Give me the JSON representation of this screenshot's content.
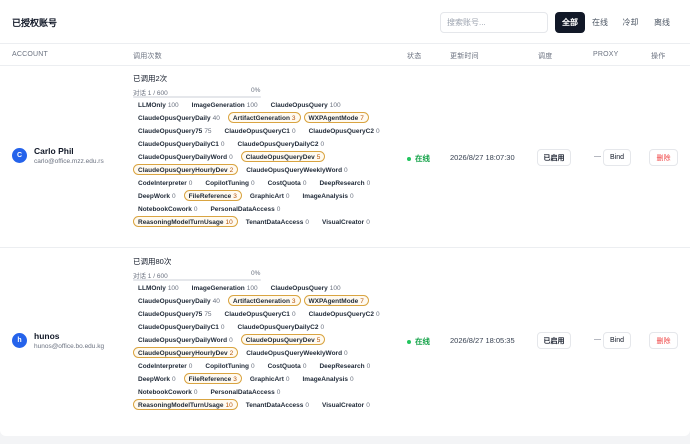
{
  "header": {
    "title": "已授权账号",
    "search_placeholder": "搜索账号...",
    "filters": [
      "全部",
      "在线",
      "冷却",
      "离线"
    ]
  },
  "columns": {
    "account": "ACCOUNT",
    "usage": "调用次数",
    "status": "状态",
    "updated": "更新时间",
    "schedule": "调度",
    "proxy": "PROXY",
    "actions": "操作"
  },
  "accounts": [
    {
      "avatar": "C",
      "name": "Carlo Phil",
      "email": "carlo@office.mzz.edu.rs",
      "used": "已调用2次",
      "quota": "对话 1 / 600",
      "percent_label": "0%",
      "percent_value": 0,
      "status": "在线",
      "updated": "2026/8/27 18:07:30",
      "schedule": "已启用",
      "proxy": "—",
      "bind": "Bind",
      "delete": "删除",
      "tags": [
        {
          "name": "LLMOnly",
          "count": "100",
          "hl": false
        },
        {
          "name": "ImageGeneration",
          "count": "100",
          "hl": false
        },
        {
          "name": "ClaudeOpusQuery",
          "count": "100",
          "hl": false
        },
        {
          "name": "ClaudeOpusQueryDaily",
          "count": "40",
          "hl": false
        },
        {
          "name": "ArtifactGeneration",
          "count": "3",
          "hl": true
        },
        {
          "name": "WXPAgentMode",
          "count": "7",
          "hl": true
        },
        {
          "name": "ClaudeOpusQuery75",
          "count": "75",
          "hl": false
        },
        {
          "name": "ClaudeOpusQueryC1",
          "count": "0",
          "hl": false
        },
        {
          "name": "ClaudeOpusQueryC2",
          "count": "0",
          "hl": false
        },
        {
          "name": "ClaudeOpusQueryDailyC1",
          "count": "0",
          "hl": false
        },
        {
          "name": "ClaudeOpusQueryDailyC2",
          "count": "0",
          "hl": false
        },
        {
          "name": "ClaudeOpusQueryDailyWord",
          "count": "0",
          "hl": false
        },
        {
          "name": "ClaudeOpusQueryDev",
          "count": "5",
          "hl": true
        },
        {
          "name": "ClaudeOpusQueryHourlyDev",
          "count": "2",
          "hl": true
        },
        {
          "name": "ClaudeOpusQueryWeeklyWord",
          "count": "0",
          "hl": false
        },
        {
          "name": "CodeInterpreter",
          "count": "0",
          "hl": false
        },
        {
          "name": "CopilotTuning",
          "count": "0",
          "hl": false
        },
        {
          "name": "CostQuota",
          "count": "0",
          "hl": false
        },
        {
          "name": "DeepResearch",
          "count": "0",
          "hl": false
        },
        {
          "name": "DeepWork",
          "count": "0",
          "hl": false
        },
        {
          "name": "FileReference",
          "count": "3",
          "hl": true
        },
        {
          "name": "GraphicArt",
          "count": "0",
          "hl": false
        },
        {
          "name": "ImageAnalysis",
          "count": "0",
          "hl": false
        },
        {
          "name": "NotebookCowork",
          "count": "0",
          "hl": false
        },
        {
          "name": "PersonalDataAccess",
          "count": "0",
          "hl": false
        },
        {
          "name": "ReasoningModelTurnUsage",
          "count": "10",
          "hl": true
        },
        {
          "name": "TenantDataAccess",
          "count": "0",
          "hl": false
        },
        {
          "name": "VisualCreator",
          "count": "0",
          "hl": false
        }
      ]
    },
    {
      "avatar": "h",
      "name": "hunos",
      "email": "hunos@office.bo.edu.kg",
      "used": "已调用80次",
      "quota": "对话 1 / 600",
      "percent_label": "0%",
      "percent_value": 0,
      "status": "在线",
      "updated": "2026/8/27 18:05:35",
      "schedule": "已启用",
      "proxy": "—",
      "bind": "Bind",
      "delete": "删除",
      "tags": [
        {
          "name": "LLMOnly",
          "count": "100",
          "hl": false
        },
        {
          "name": "ImageGeneration",
          "count": "100",
          "hl": false
        },
        {
          "name": "ClaudeOpusQuery",
          "count": "100",
          "hl": false
        },
        {
          "name": "ClaudeOpusQueryDaily",
          "count": "40",
          "hl": false
        },
        {
          "name": "ArtifactGeneration",
          "count": "3",
          "hl": true
        },
        {
          "name": "WXPAgentMode",
          "count": "7",
          "hl": true
        },
        {
          "name": "ClaudeOpusQuery75",
          "count": "75",
          "hl": false
        },
        {
          "name": "ClaudeOpusQueryC1",
          "count": "0",
          "hl": false
        },
        {
          "name": "ClaudeOpusQueryC2",
          "count": "0",
          "hl": false
        },
        {
          "name": "ClaudeOpusQueryDailyC1",
          "count": "0",
          "hl": false
        },
        {
          "name": "ClaudeOpusQueryDailyC2",
          "count": "0",
          "hl": false
        },
        {
          "name": "ClaudeOpusQueryDailyWord",
          "count": "0",
          "hl": false
        },
        {
          "name": "ClaudeOpusQueryDev",
          "count": "5",
          "hl": true
        },
        {
          "name": "ClaudeOpusQueryHourlyDev",
          "count": "2",
          "hl": true
        },
        {
          "name": "ClaudeOpusQueryWeeklyWord",
          "count": "0",
          "hl": false
        },
        {
          "name": "CodeInterpreter",
          "count": "0",
          "hl": false
        },
        {
          "name": "CopilotTuning",
          "count": "0",
          "hl": false
        },
        {
          "name": "CostQuota",
          "count": "0",
          "hl": false
        },
        {
          "name": "DeepResearch",
          "count": "0",
          "hl": false
        },
        {
          "name": "DeepWork",
          "count": "0",
          "hl": false
        },
        {
          "name": "FileReference",
          "count": "3",
          "hl": true
        },
        {
          "name": "GraphicArt",
          "count": "0",
          "hl": false
        },
        {
          "name": "ImageAnalysis",
          "count": "0",
          "hl": false
        },
        {
          "name": "NotebookCowork",
          "count": "0",
          "hl": false
        },
        {
          "name": "PersonalDataAccess",
          "count": "0",
          "hl": false
        },
        {
          "name": "ReasoningModelTurnUsage",
          "count": "10",
          "hl": true
        },
        {
          "name": "TenantDataAccess",
          "count": "0",
          "hl": false
        },
        {
          "name": "VisualCreator",
          "count": "0",
          "hl": false
        }
      ]
    }
  ],
  "colors": {
    "accent": "#2563eb",
    "online": "#16a34a",
    "danger": "#ef4444",
    "highlight_border": "#d9a441"
  }
}
